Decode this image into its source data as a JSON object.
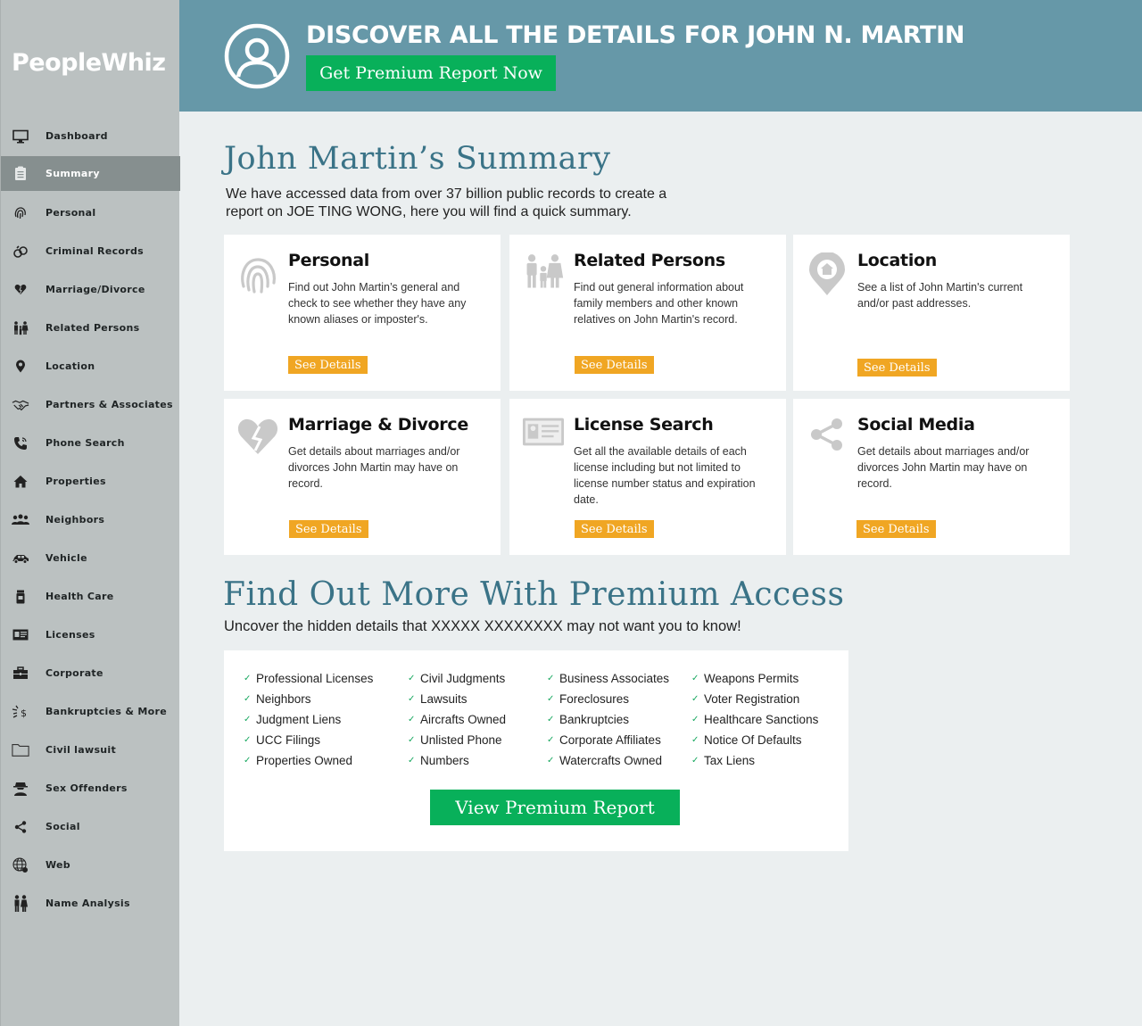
{
  "app": {
    "logo": "PeopleWhiz"
  },
  "sidebar": {
    "items": [
      {
        "label": "Dashboard",
        "icon": "monitor-icon",
        "active": false
      },
      {
        "label": "Summary",
        "icon": "clipboard-icon",
        "active": true
      },
      {
        "label": "Personal",
        "icon": "fingerprint-icon",
        "active": false
      },
      {
        "label": "Criminal Records",
        "icon": "handcuffs-icon",
        "active": false
      },
      {
        "label": "Marriage/Divorce",
        "icon": "broken-heart-icon",
        "active": false
      },
      {
        "label": "Related Persons",
        "icon": "family-icon",
        "active": false
      },
      {
        "label": "Location",
        "icon": "map-pin-icon",
        "active": false
      },
      {
        "label": "Partners & Associates",
        "icon": "handshake-icon",
        "active": false
      },
      {
        "label": "Phone Search",
        "icon": "phone-icon",
        "active": false
      },
      {
        "label": "Properties",
        "icon": "house-icon",
        "active": false
      },
      {
        "label": "Neighbors",
        "icon": "group-icon",
        "active": false
      },
      {
        "label": "Vehicle",
        "icon": "car-icon",
        "active": false
      },
      {
        "label": "Health Care",
        "icon": "pill-bottle-icon",
        "active": false
      },
      {
        "label": "Licenses",
        "icon": "id-card-icon",
        "active": false
      },
      {
        "label": "Corporate",
        "icon": "briefcase-icon",
        "active": false
      },
      {
        "label": "Bankruptcies & More",
        "icon": "broken-dollar-icon",
        "active": false
      },
      {
        "label": "Civil lawsuit",
        "icon": "folder-icon",
        "active": false
      },
      {
        "label": "Sex Offenders",
        "icon": "spy-icon",
        "active": false
      },
      {
        "label": "Social",
        "icon": "share-icon",
        "active": false
      },
      {
        "label": "Web",
        "icon": "globe-icon",
        "active": false
      },
      {
        "label": "Name Analysis",
        "icon": "people-pair-icon",
        "active": false
      }
    ]
  },
  "header": {
    "title": "DISCOVER ALL THE DETAILS FOR JOHN N. MARTIN",
    "button_label": "Get Premium Report Now",
    "avatar_icon": "user-circle-icon"
  },
  "summary": {
    "title": "John Martin’s Summary",
    "description": "We have accessed data from over 37 billion public records to create a report on JOE TING WONG, here you will find a quick summary.",
    "cards": [
      {
        "title": "Personal",
        "icon": "fingerprint-icon",
        "description": "Find out John Martin’s general and check to see whether they have any known aliases or imposter's.",
        "button": "See Details"
      },
      {
        "title": "Related Persons",
        "icon": "family-icon",
        "description": "Find out general information about family members and other known relatives on John Martin's record.",
        "button": "See Details"
      },
      {
        "title": "Location",
        "icon": "map-pin-home-icon",
        "description": "See a list of John Martin's current and/or past addresses.",
        "button": "See Details"
      },
      {
        "title": "Marriage & Divorce",
        "icon": "broken-heart-icon",
        "description": "Get details about marriages and/or divorces John Martin may have on record.",
        "button": "See Details"
      },
      {
        "title": "License Search",
        "icon": "id-card-icon",
        "description": "Get all the available details of each license including but not limited to license number status and expiration date.",
        "button": "See Details"
      },
      {
        "title": "Social Media",
        "icon": "share-icon",
        "description": "Get details about marriages and/or divorces John Martin may have on record.",
        "button": "See Details"
      }
    ]
  },
  "premium": {
    "title": "Find Out More With Premium Access",
    "description": "Uncover the hidden details that XXXXX XXXXXXXX may not want you to know!",
    "columns": [
      [
        "Professional Licenses",
        "Neighbors",
        "Judgment Liens",
        "UCC Filings",
        "Properties Owned"
      ],
      [
        "Civil Judgments",
        "Lawsuits",
        "Aircrafts Owned",
        "Unlisted Phone",
        "Numbers"
      ],
      [
        "Business Associates",
        "Foreclosures",
        "Bankruptcies",
        "Corporate Affiliates",
        "Watercrafts Owned"
      ],
      [
        "Weapons Permits",
        "Voter Registration",
        "Healthcare Sanctions",
        "Notice Of Defaults",
        "Tax Liens"
      ]
    ],
    "button_label": "View Premium Report",
    "check_icon": "check-icon"
  },
  "colors": {
    "banner": "#6698a8",
    "sidebar": "#bbc1c1",
    "sidebar_active": "#868f8f",
    "green_button": "#08b05a",
    "orange_button": "#f0a623",
    "heading_teal": "#3a7387",
    "background": "#ebeff0"
  }
}
